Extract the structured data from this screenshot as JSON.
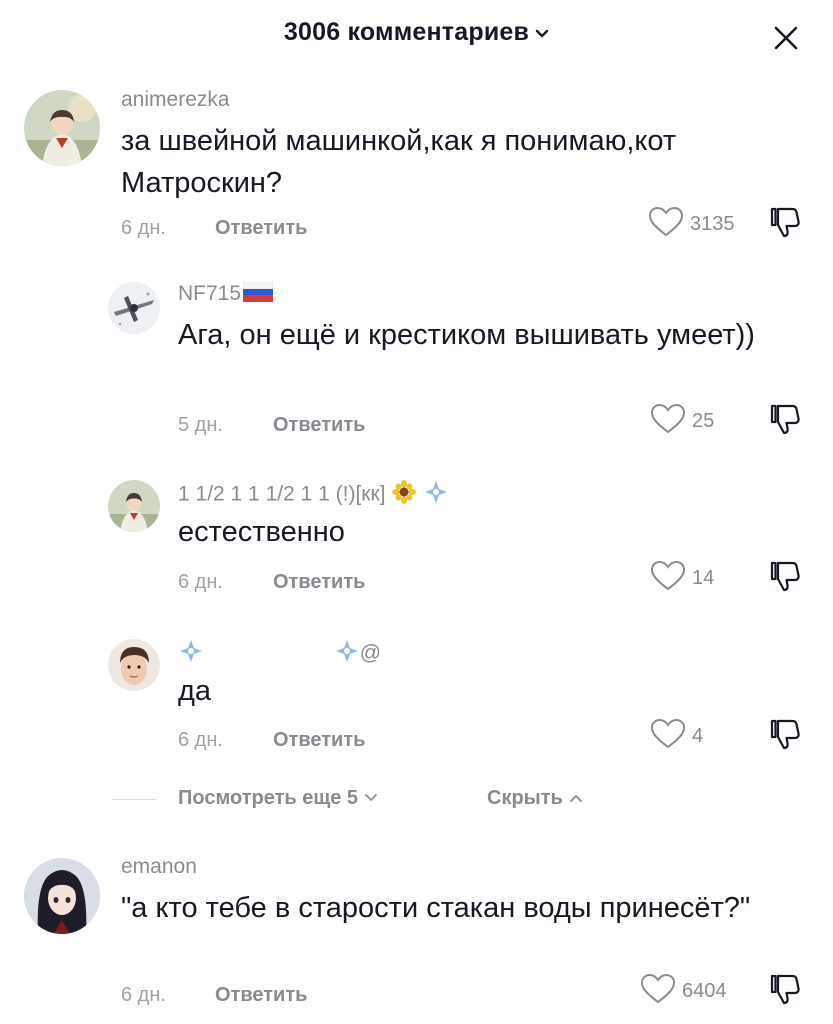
{
  "header": {
    "title": "3006 комментариев"
  },
  "comments": [
    {
      "username": "animerezka",
      "text": "за швейной машинкой,как я понимаю,кот Матроскин?",
      "time": "6 дн.",
      "reply": "Ответить",
      "likes": "3135"
    },
    {
      "username": "NF715",
      "text": "Ага, он ещё и крестиком вышивать умеет))",
      "time": "5 дн.",
      "reply": "Ответить",
      "likes": "25"
    },
    {
      "username": "1 1/2 1 1 1/2 1 1 (!)[кк]",
      "text": "естественно",
      "time": "6 дн.",
      "reply": "Ответить",
      "likes": "14"
    },
    {
      "username": "@",
      "text": "да",
      "time": "6 дн.",
      "reply": "Ответить",
      "likes": "4"
    },
    {
      "username": "emanon",
      "text": "\"а кто тебе в старости стакан воды принесёт?\"",
      "time": "6 дн.",
      "reply": "Ответить",
      "likes": "6404"
    }
  ],
  "replies_toggle": {
    "more": "Посмотреть еще 5",
    "hide": "Скрыть"
  },
  "colors": {
    "text": "#161823",
    "muted": "#8a8b91",
    "divider": "#d9d9db"
  }
}
